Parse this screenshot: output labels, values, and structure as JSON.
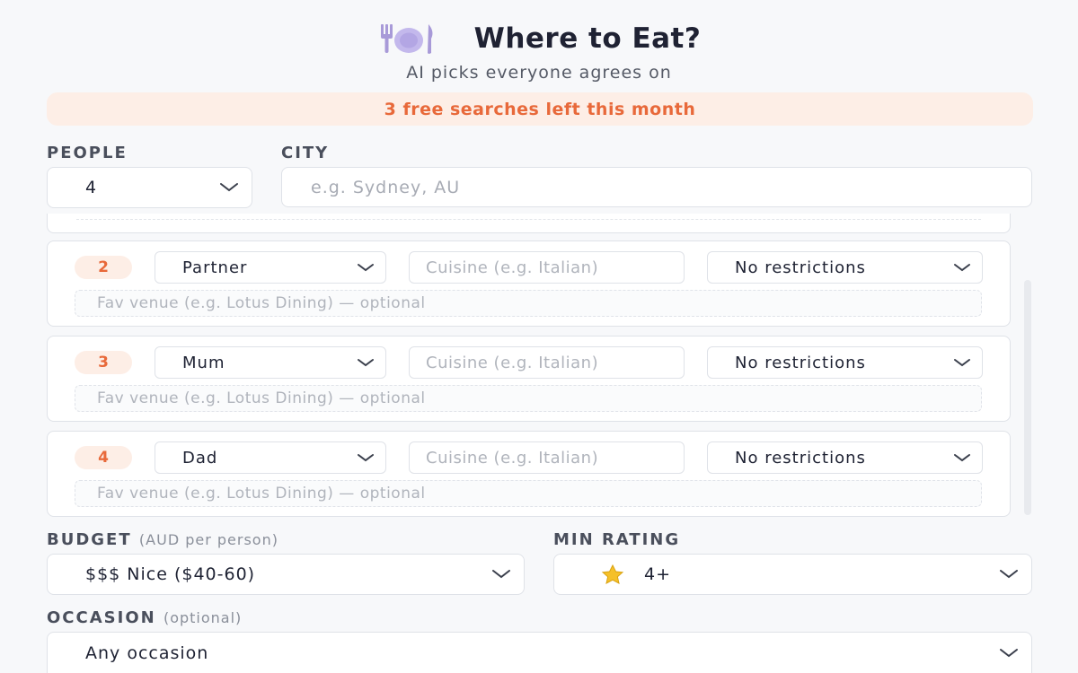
{
  "header": {
    "title": "Where to Eat?",
    "subtitle": "AI picks everyone agrees on",
    "icon": "plate-cutlery-icon"
  },
  "banner": {
    "text": "3 free searches left this month"
  },
  "people": {
    "label": "PEOPLE",
    "value": "4"
  },
  "city": {
    "label": "CITY",
    "placeholder": "e.g. Sydney, AU"
  },
  "persons": [
    {
      "number": "2",
      "role": "Partner",
      "cuisine_placeholder": "Cuisine (e.g. Italian)",
      "diet": "No restrictions",
      "fav_placeholder": "Fav venue (e.g. Lotus Dining) — optional"
    },
    {
      "number": "3",
      "role": "Mum",
      "cuisine_placeholder": "Cuisine (e.g. Italian)",
      "diet": "No restrictions",
      "fav_placeholder": "Fav venue (e.g. Lotus Dining) — optional"
    },
    {
      "number": "4",
      "role": "Dad",
      "cuisine_placeholder": "Cuisine (e.g. Italian)",
      "diet": "No restrictions",
      "fav_placeholder": "Fav venue (e.g. Lotus Dining) — optional"
    }
  ],
  "budget": {
    "label": "BUDGET",
    "sublabel": "(AUD per person)",
    "value": "$$$ Nice ($40-60)"
  },
  "rating": {
    "label": "MIN RATING",
    "value": "4+",
    "icon": "star-icon"
  },
  "occasion": {
    "label": "OCCASION",
    "sublabel": "(optional)",
    "value": "Any occasion"
  },
  "colors": {
    "accent": "#e8693a",
    "accent_bg": "#fdeee6",
    "border": "#dfe2e8"
  }
}
